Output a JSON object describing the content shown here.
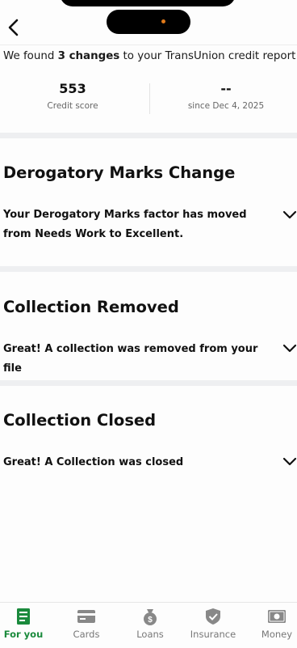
{
  "header": {
    "back_icon": "chevron-left-icon"
  },
  "summary": {
    "prefix": "We found ",
    "changes": "3 changes",
    "suffix": " to your TransUnion credit report"
  },
  "stats": {
    "score_value": "553",
    "score_label": "Credit score",
    "change_value": "--",
    "change_label": "since Dec 4, 2025"
  },
  "sections": [
    {
      "title": "Derogatory Marks Change",
      "body": "Your Derogatory Marks factor has moved from Needs Work to Excellent."
    },
    {
      "title": "Collection Removed",
      "body": "Great! A collection was removed from your file"
    },
    {
      "title": "Collection Closed",
      "body": "Great! A Collection was closed"
    }
  ],
  "nav": [
    {
      "label": "For you",
      "icon": "document-icon",
      "active": true
    },
    {
      "label": "Cards",
      "icon": "credit-card-icon"
    },
    {
      "label": "Loans",
      "icon": "money-bag-icon"
    },
    {
      "label": "Insurance",
      "icon": "shield-check-icon"
    },
    {
      "label": "Money",
      "icon": "cash-icon"
    }
  ],
  "colors": {
    "accent_green": "#1a8a3c",
    "inactive_gray": "#777777",
    "divider": "#eeeff1"
  }
}
